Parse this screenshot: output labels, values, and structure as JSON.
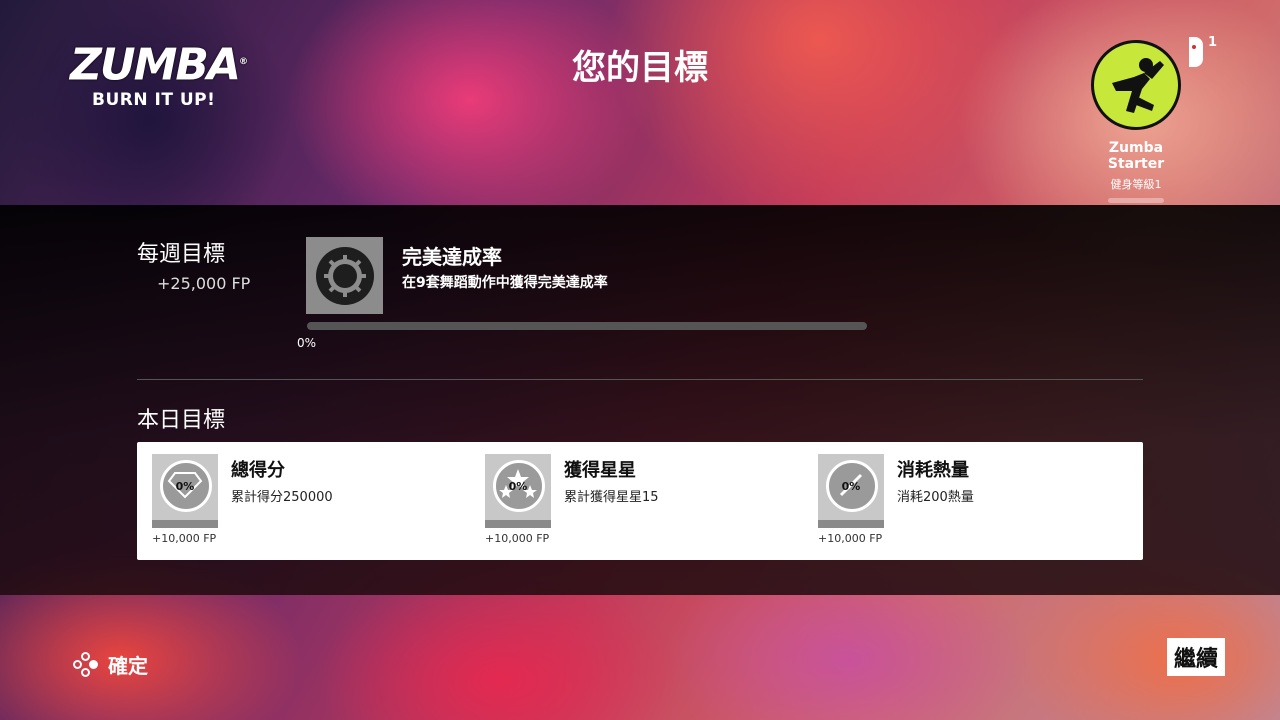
{
  "header": {
    "logo_text": "ZUMBA",
    "logo_trademark": "®",
    "logo_subtitle": "BURN IT UP!",
    "title": "您的目標"
  },
  "profile": {
    "name": "Zumba Starter",
    "level": "健身等級1",
    "controller_player": "1"
  },
  "weekly": {
    "title": "每週目標",
    "reward": "+25,000 FP",
    "goal_name": "完美達成率",
    "goal_desc": "在9套舞蹈動作中獲得完美達成率",
    "progress_label": "0%",
    "progress_value": 0
  },
  "daily": {
    "title": "本日目標",
    "goals": [
      {
        "name": "總得分",
        "desc": "累計得分250000",
        "percent": "0%",
        "reward": "+10,000 FP",
        "icon": "diamond-icon"
      },
      {
        "name": "獲得星星",
        "desc": "累計獲得星星15",
        "percent": "0%",
        "reward": "+10,000 FP",
        "icon": "stars-icon"
      },
      {
        "name": "消耗熱量",
        "desc": "消耗200熱量",
        "percent": "0%",
        "reward": "+10,000 FP",
        "icon": "compass-icon"
      }
    ]
  },
  "footer": {
    "confirm_label": "確定",
    "continue_label": "繼續"
  },
  "colors": {
    "accent": "#c7e83a",
    "panel": "#ffffff"
  }
}
